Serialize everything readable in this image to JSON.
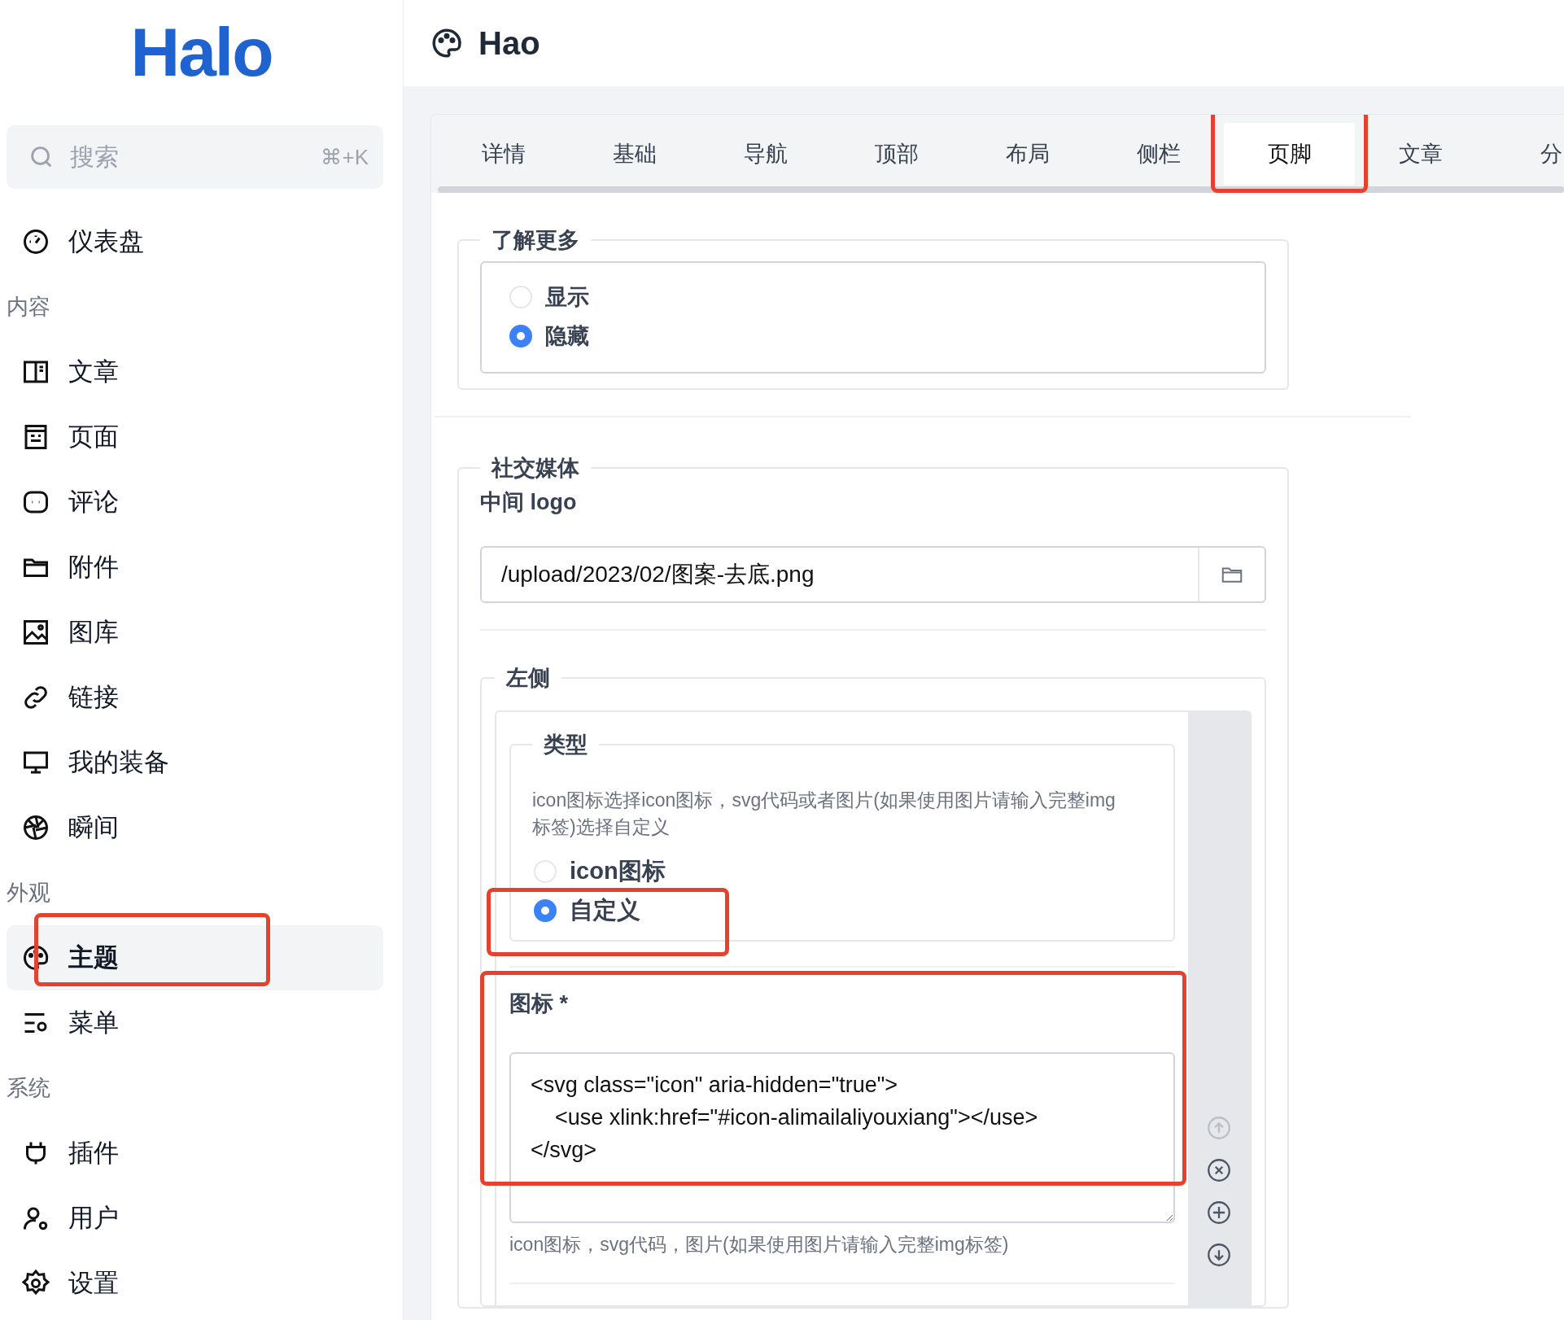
{
  "logo": "Halo",
  "search": {
    "placeholder": "搜索",
    "shortcut": "⌘+K"
  },
  "sidebar": {
    "groups": [
      {
        "items": [
          {
            "label": "仪表盘",
            "selected": false,
            "highlighted": false
          }
        ]
      },
      {
        "heading": "内容",
        "items": [
          {
            "label": "文章",
            "selected": false,
            "highlighted": false
          },
          {
            "label": "页面",
            "selected": false,
            "highlighted": false
          },
          {
            "label": "评论",
            "selected": false,
            "highlighted": false
          },
          {
            "label": "附件",
            "selected": false,
            "highlighted": false
          },
          {
            "label": "图库",
            "selected": false,
            "highlighted": false
          },
          {
            "label": "链接",
            "selected": false,
            "highlighted": false
          },
          {
            "label": "我的装备",
            "selected": false,
            "highlighted": false
          },
          {
            "label": "瞬间",
            "selected": false,
            "highlighted": false
          }
        ]
      },
      {
        "heading": "外观",
        "items": [
          {
            "label": "主题",
            "selected": true,
            "highlighted": true
          },
          {
            "label": "菜单",
            "selected": false,
            "highlighted": false
          }
        ]
      },
      {
        "heading": "系统",
        "items": [
          {
            "label": "插件",
            "selected": false,
            "highlighted": false
          },
          {
            "label": "用户",
            "selected": false,
            "highlighted": false
          },
          {
            "label": "设置",
            "selected": false,
            "highlighted": false
          }
        ]
      }
    ]
  },
  "header": {
    "title": "Hao"
  },
  "tabs": [
    {
      "label": "详情",
      "selected": false,
      "highlighted": false
    },
    {
      "label": "基础",
      "selected": false,
      "highlighted": false
    },
    {
      "label": "导航",
      "selected": false,
      "highlighted": false
    },
    {
      "label": "顶部",
      "selected": false,
      "highlighted": false
    },
    {
      "label": "布局",
      "selected": false,
      "highlighted": false
    },
    {
      "label": "侧栏",
      "selected": false,
      "highlighted": false
    },
    {
      "label": "页脚",
      "selected": true,
      "highlighted": true
    },
    {
      "label": "文章",
      "selected": false,
      "highlighted": false
    },
    {
      "label": "分",
      "selected": false,
      "highlighted": false
    }
  ],
  "learn_more": {
    "legend": "了解更多",
    "options": [
      {
        "label": "显示",
        "selected": false
      },
      {
        "label": "隐藏",
        "selected": true
      }
    ]
  },
  "social": {
    "legend": "社交媒体",
    "logo_field": {
      "label": "中间 logo",
      "value": "/upload/2023/02/图案-去底.png"
    },
    "left": {
      "legend": "左侧",
      "type": {
        "legend": "类型",
        "help": "icon图标选择icon图标，svg代码或者图片(如果使用图片请输入完整img标签)选择自定义",
        "options": [
          {
            "label": "icon图标",
            "selected": false,
            "highlighted": false
          },
          {
            "label": "自定义",
            "selected": true,
            "highlighted": true
          }
        ]
      },
      "icon_field": {
        "label": "图标 *",
        "value": "<svg class=\"icon\" aria-hidden=\"true\">\n    <use xlink:href=\"#icon-alimailaliyouxiang\"></use>\n</svg>",
        "help": "icon图标，svg代码，图片(如果使用图片请输入完整img标签)",
        "highlighted": true
      },
      "item_actions": [
        {
          "kind": "up",
          "disabled": true
        },
        {
          "kind": "remove",
          "disabled": false
        },
        {
          "kind": "add",
          "disabled": false
        },
        {
          "kind": "down",
          "disabled": false
        }
      ]
    }
  }
}
